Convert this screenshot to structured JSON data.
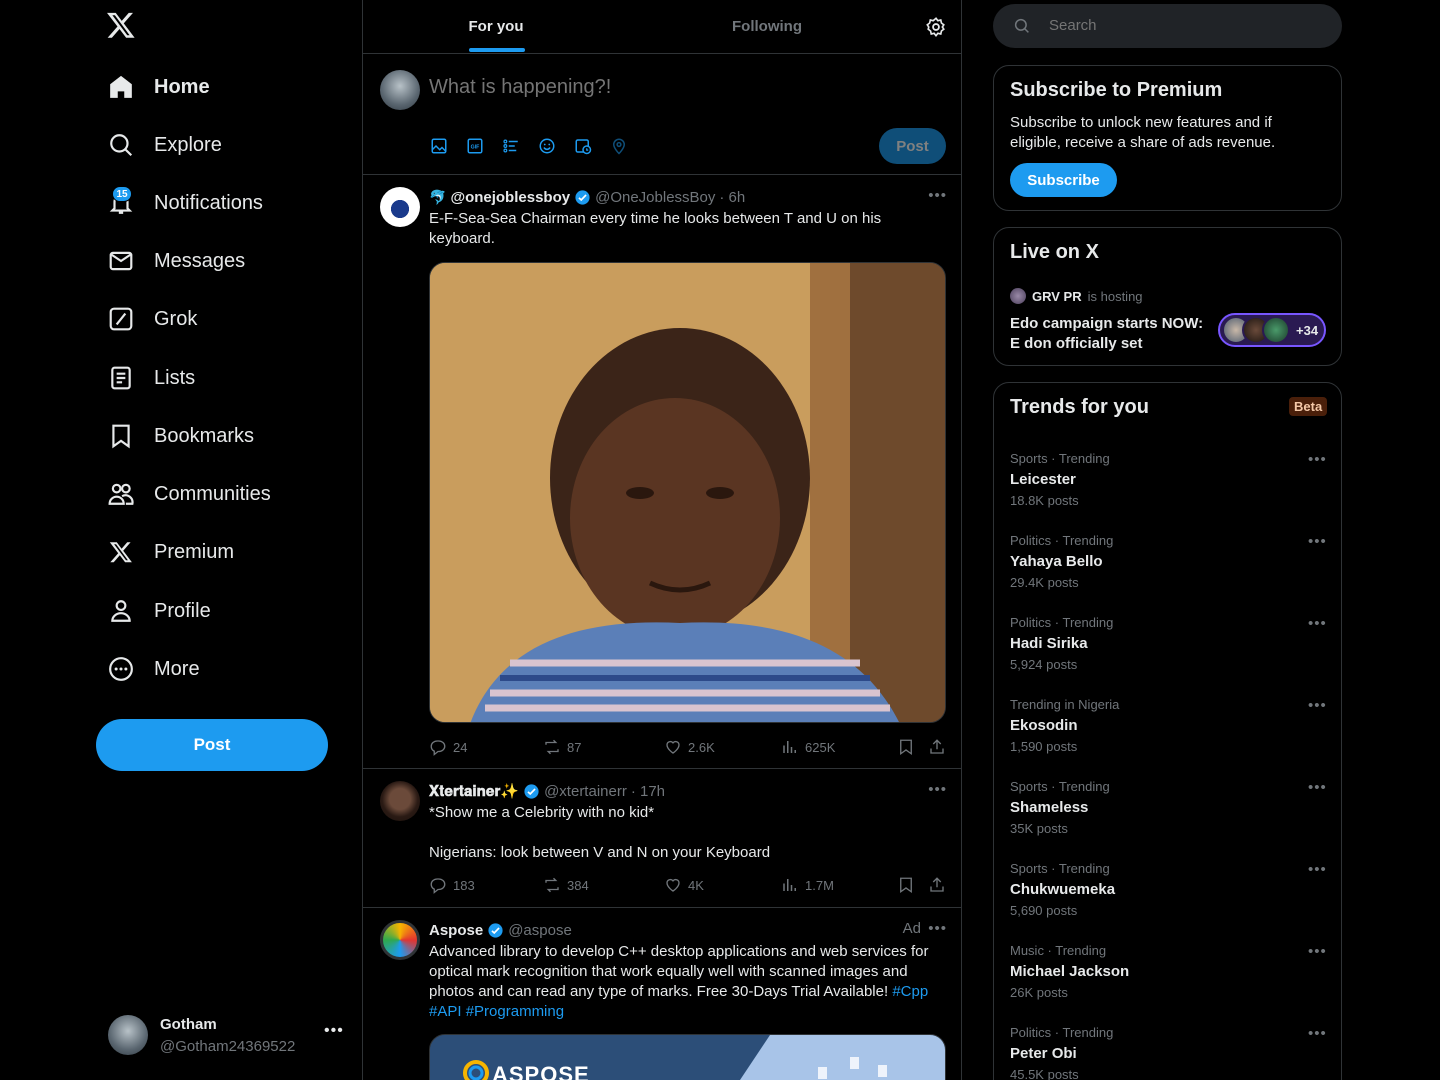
{
  "nav": {
    "items": [
      {
        "label": "Home",
        "icon": "home-icon"
      },
      {
        "label": "Explore",
        "icon": "search-icon"
      },
      {
        "label": "Notifications",
        "icon": "bell-icon"
      },
      {
        "label": "Messages",
        "icon": "envelope-icon"
      },
      {
        "label": "Grok",
        "icon": "grok-icon"
      },
      {
        "label": "Lists",
        "icon": "list-icon"
      },
      {
        "label": "Bookmarks",
        "icon": "bookmark-icon"
      },
      {
        "label": "Communities",
        "icon": "people-icon"
      },
      {
        "label": "Premium",
        "icon": "x-logo-icon"
      },
      {
        "label": "Profile",
        "icon": "person-icon"
      },
      {
        "label": "More",
        "icon": "more-circle-icon"
      }
    ],
    "notifications_badge": "15",
    "post_label": "Post"
  },
  "account": {
    "name": "Gotham",
    "handle": "@Gotham24369522"
  },
  "tabs": {
    "for_you": "For you",
    "following": "Following"
  },
  "composer": {
    "placeholder": "What is happening?!",
    "post_label": "Post"
  },
  "tweets": [
    {
      "name": "@onejoblessboy",
      "handle": "@OneJoblessBoy",
      "time": "· 6h",
      "text": "E-F-Sea-Sea Chairman every time he looks between T and U on his keyboard.",
      "replies": "24",
      "reposts": "87",
      "likes": "2.6K",
      "views": "625K"
    },
    {
      "name": "𝐗𝐭𝐞𝐫𝐭𝐚𝐢𝐧𝐞𝐫✨",
      "handle": "@xtertainerr",
      "time": "· 17h",
      "text": "*Show me a Celebrity with no kid*\n\nNigerians: look between V and N on your Keyboard",
      "replies": "183",
      "reposts": "384",
      "likes": "4K",
      "views": "1.7M"
    },
    {
      "name": "Aspose",
      "handle": "@aspose",
      "ad": "Ad",
      "text": "Advanced library to develop C++ desktop applications and web services for optical mark recognition that work equally well with scanned images and photos and can read any type of marks. Free 30-Days Trial Available! ",
      "hashtags": [
        "#Cpp",
        "#API",
        "#Programming"
      ],
      "media_text": "ASPOSE"
    }
  ],
  "search": {
    "placeholder": "Search"
  },
  "premium": {
    "title": "Subscribe to Premium",
    "text": "Subscribe to unlock new features and if eligible, receive a share of ads revenue.",
    "button": "Subscribe"
  },
  "live": {
    "title": "Live on X",
    "host": "GRV PR",
    "hosting": "is hosting",
    "space_title": "Edo campaign starts NOW: E don officially set",
    "count": "+34"
  },
  "trends": {
    "title": "Trends for you",
    "beta": "Beta",
    "items": [
      {
        "meta": "Sports · Trending",
        "name": "Leicester",
        "posts": "18.8K posts"
      },
      {
        "meta": "Politics · Trending",
        "name": "Yahaya Bello",
        "posts": "29.4K posts"
      },
      {
        "meta": "Politics · Trending",
        "name": "Hadi Sirika",
        "posts": "5,924 posts"
      },
      {
        "meta": "Trending in Nigeria",
        "name": "Ekosodin",
        "posts": "1,590 posts"
      },
      {
        "meta": "Sports · Trending",
        "name": "Shameless",
        "posts": "35K posts"
      },
      {
        "meta": "Sports · Trending",
        "name": "Chukwuemeka",
        "posts": "5,690 posts"
      },
      {
        "meta": "Music · Trending",
        "name": "Michael Jackson",
        "posts": "26K posts"
      },
      {
        "meta": "Politics · Trending",
        "name": "Peter Obi",
        "posts": "45.5K posts"
      }
    ]
  },
  "colors": {
    "accent": "#1d9bf0",
    "background": "#000000",
    "border": "#2f3336",
    "muted": "#71767b"
  }
}
